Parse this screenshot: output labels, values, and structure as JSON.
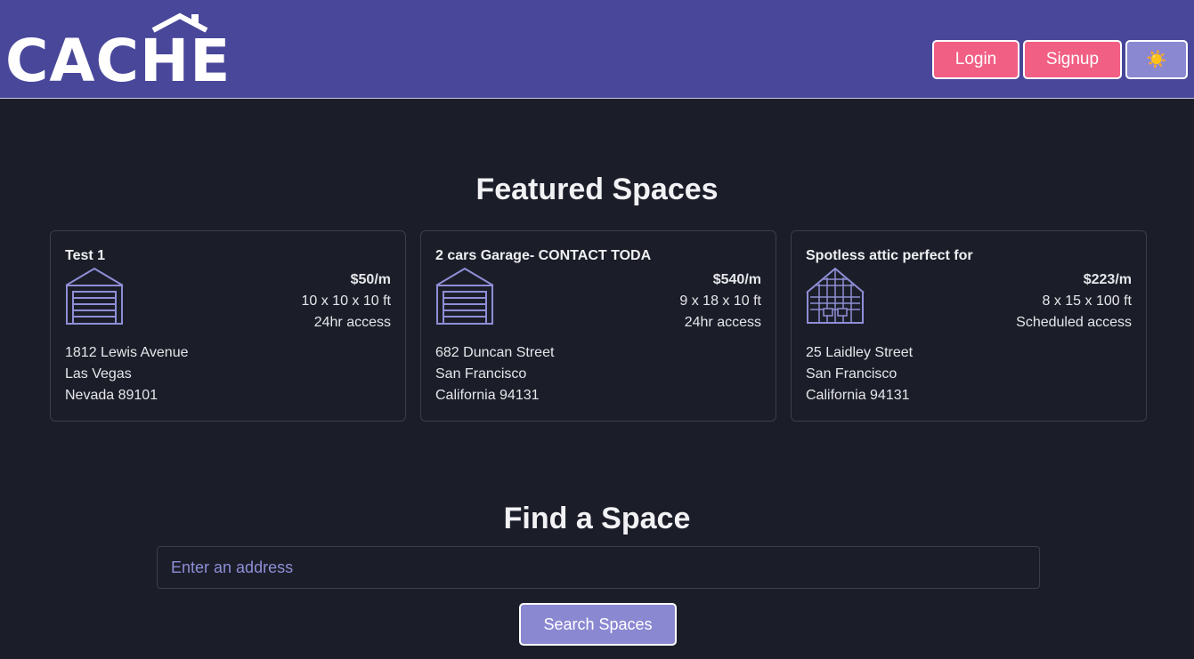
{
  "brand": {
    "name": "CACHE"
  },
  "nav": {
    "login_label": "Login",
    "signup_label": "Signup",
    "theme_icon": "☀️"
  },
  "featured": {
    "title": "Featured Spaces",
    "cards": [
      {
        "title": "Test 1",
        "icon": "garage-icon",
        "price": "$50/m",
        "dimensions": "10 x 10 x 10 ft",
        "access": "24hr access",
        "street": "1812 Lewis Avenue",
        "city": "Las Vegas",
        "state_zip": "Nevada 89101"
      },
      {
        "title": "2 cars Garage- CONTACT TODA",
        "icon": "garage-icon",
        "price": "$540/m",
        "dimensions": "9 x 18 x 10 ft",
        "access": "24hr access",
        "street": "682 Duncan Street",
        "city": "San Francisco",
        "state_zip": "California 94131"
      },
      {
        "title": "Spotless attic perfect for",
        "icon": "attic-icon",
        "price": "$223/m",
        "dimensions": "8 x 15 x 100 ft",
        "access": "Scheduled access",
        "street": "25 Laidley Street",
        "city": "San Francisco",
        "state_zip": "California 94131"
      }
    ]
  },
  "find": {
    "title": "Find a Space",
    "placeholder": "Enter an address",
    "button_label": "Search Spaces"
  },
  "colors": {
    "header_bg": "#48479a",
    "page_bg": "#1b1e29",
    "primary_button": "#f25f84",
    "accent_button": "#8b88d2"
  }
}
